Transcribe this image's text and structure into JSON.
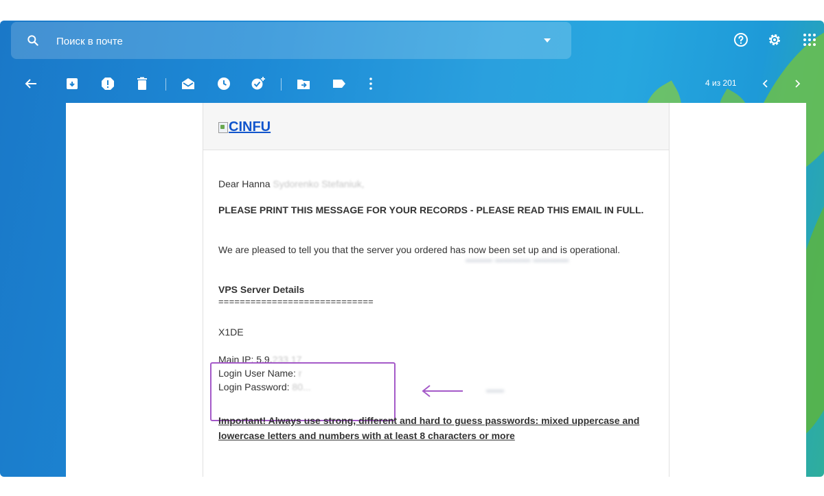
{
  "search": {
    "placeholder": "Поиск в почте"
  },
  "toolbar": {
    "counter": "4 из 201",
    "icons": [
      "back-arrow-icon",
      "archive-icon",
      "report-spam-icon",
      "delete-icon",
      "mark-unread-icon",
      "snooze-icon",
      "add-to-tasks-icon",
      "move-to-icon",
      "label-icon",
      "more-vert-icon",
      "newer-chevron-icon",
      "older-chevron-icon"
    ]
  },
  "email": {
    "logo_alt": "CINFU",
    "greeting": "Dear Hanna",
    "greeting_name": "Sydorenko Stefaniuk,",
    "heading": "PLEASE PRINT THIS MESSAGE FOR YOUR RECORDS - PLEASE READ THIS EMAIL IN FULL.",
    "intro": "We are pleased to tell you that the server you ordered has now been set up and is operational.",
    "details_title": "VPS Server Details",
    "separator": "=============================",
    "plan": "X1DE",
    "main_ip_label": "Main IP: 5.9.",
    "main_ip_hidden": "233.17",
    "login_user_label": "Login User Name:",
    "login_user_hidden": "r",
    "login_password_label": "Login Password:",
    "login_password_hidden": "80...",
    "important": "Important! Always use strong, different and hard to guess passwords: mixed uppercase and lowercase letters and numbers with at least 8 characters or more"
  },
  "colors": {
    "accent": "#1a78c8",
    "highlight_box": "#a459c8",
    "link": "#1155cc"
  }
}
